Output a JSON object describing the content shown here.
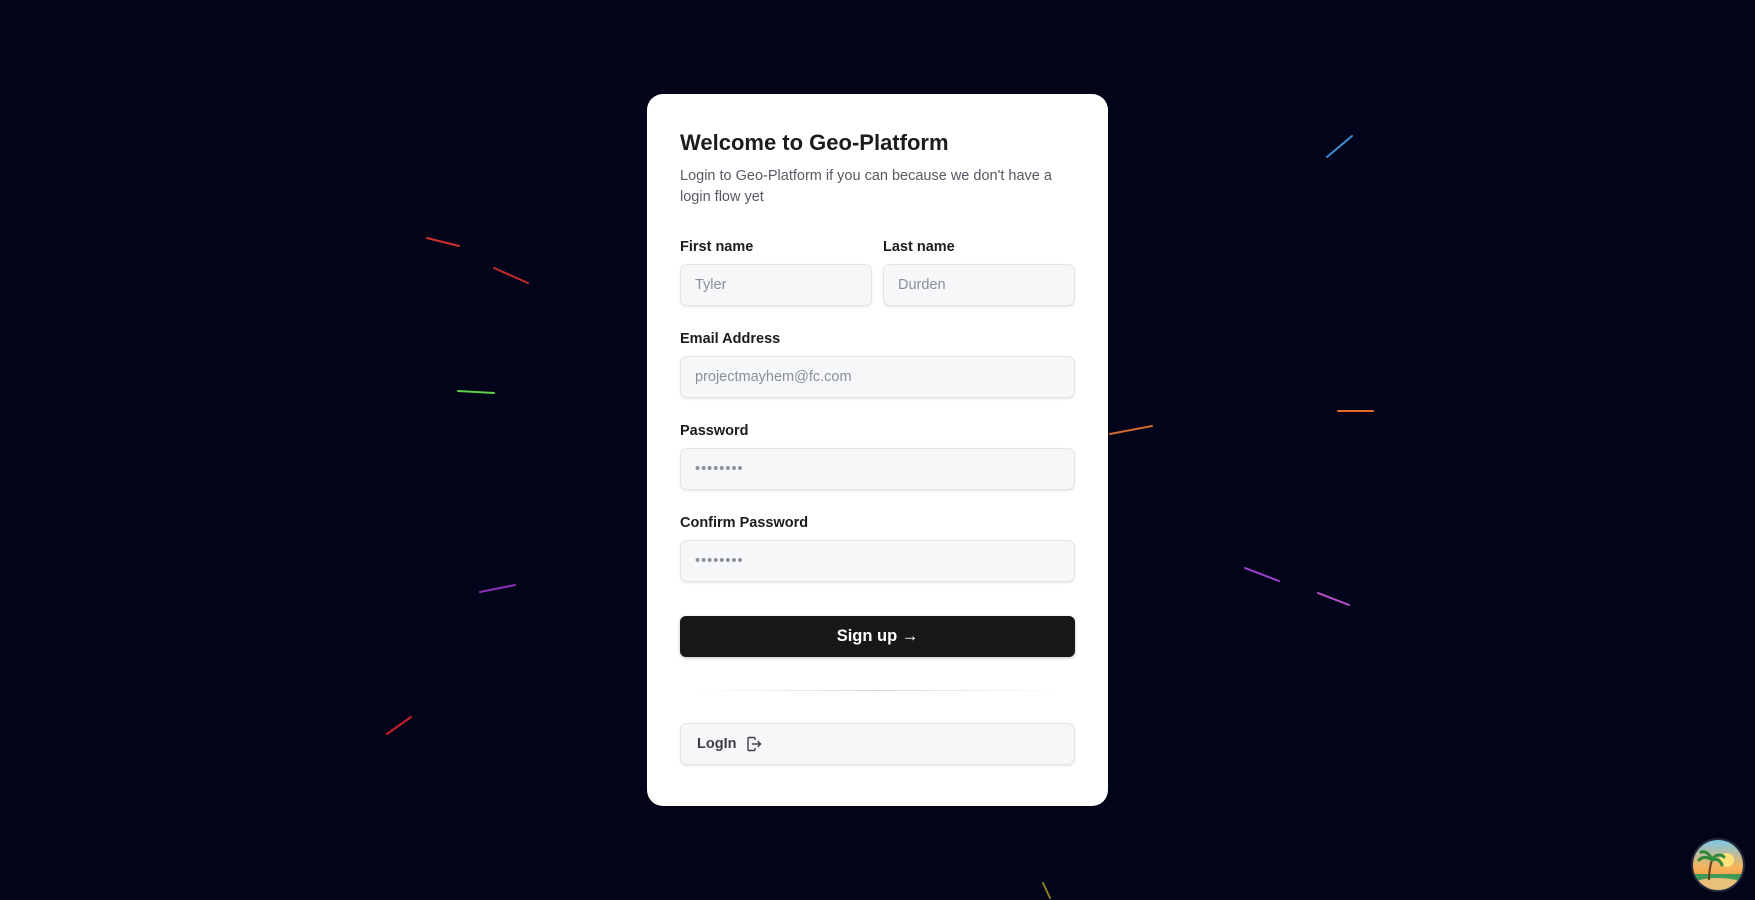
{
  "colors": {
    "background": "#02051a",
    "card": "#ffffff",
    "primary_button": "#18181b",
    "streaks": [
      "#3a8fd6",
      "#d0302c",
      "#c72a2a",
      "#5fd04a",
      "#e46a2a",
      "#d26a30",
      "#8a2fb5",
      "#a040d0",
      "#c050d0",
      "#c8202a",
      "#8a7a20"
    ]
  },
  "form": {
    "title": "Welcome to Geo-Platform",
    "subtitle": "Login to Geo-Platform if you can because we don't have a login flow yet",
    "first_name": {
      "label": "First name",
      "placeholder": "Tyler"
    },
    "last_name": {
      "label": "Last name",
      "placeholder": "Durden"
    },
    "email": {
      "label": "Email Address",
      "placeholder": "projectmayhem@fc.com"
    },
    "password": {
      "label": "Password",
      "placeholder": "••••••••"
    },
    "confirm_password": {
      "label": "Confirm Password",
      "placeholder": "••••••••"
    },
    "signup_label": "Sign up →",
    "login_label": "LogIn",
    "login_icon": "login-icon"
  },
  "avatar": {
    "icon": "beach-avatar-icon"
  }
}
